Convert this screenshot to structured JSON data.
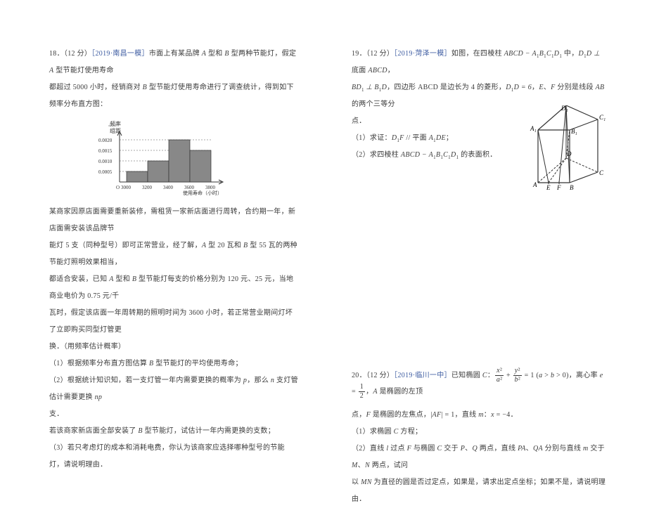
{
  "q18": {
    "num": "18．（12 分）",
    "src": "［2019·南昌一模］",
    "p1a": "市面上有某品牌 ",
    "p1b": " 型和 ",
    "p1c": " 型两种节能灯，假定 ",
    "p1d": " 型节能灯使用寿命",
    "p2a": "都超过 5000 小时，经销商对 ",
    "p2b": " 型节能灯使用寿命进行了调查统计，得到如下频率分布直方图：",
    "p3": "某商家因原店面需要重新装修，需租赁一家新店面进行周转，合约期一年，新店面需安装该品牌节",
    "p4a": "能灯 5 支（同种型号）即可正常营业，经了解，",
    "p4b": " 型 20 瓦和 ",
    "p4c": " 型 55 瓦的两种节能灯照明效果相当，",
    "p5a": "都适合安装，已知 ",
    "p5b": " 型和 ",
    "p5c": " 型节能灯每支的价格分别为 120 元、25 元，当地商业电价为 0.75 元/千",
    "p6": "瓦时，假定该店面一年周转期的照明时间为 3600 小时，若正常营业期间灯坏了立即购买同型灯管更",
    "p7": "换．（用频率估计概率）",
    "q1a": "（1）根据频率分布直方图估算 ",
    "q1b": " 型节能灯的平均使用寿命；",
    "q2a": "（2）根据统计知识知，若一支灯管一年内需要更换的概率为 ",
    "q2b": "，那么 ",
    "q2c": " 支灯管估计需要更换 ",
    "q3": "支．",
    "q4a": "若该商家新店面全部安装了 ",
    "q4b": " 型节能灯，试估计一年内需更换的支数；",
    "q5": "（3）若只考虑灯的成本和消耗电费，你认为该商家应选择哪种型号的节能灯，请说明理由．"
  },
  "q19": {
    "num": "19．（12 分）",
    "src": "［2019·菏泽一模］",
    "p1a": "如图，在四棱柱 ",
    "p1b": " 中，",
    "p1c": " 底面 ",
    "p1d": "，",
    "p2a": " 是边长为 4 的菱形，",
    "p2b": "，",
    "p2c": "、",
    "p2d": " 分别是线段 ",
    "p2e": " 的两个三等分",
    "p3": "点．",
    "q1a": "（1）求证：",
    "q1b": " 平面 ",
    "q1c": "；",
    "q2a": "（2）求四棱柱 ",
    "q2b": " 的表面积．",
    "solid": "ABCD-A1B1C1D1",
    "BD1_perp_B1D": "BD₁⊥B₁D",
    "D1D_perp": "D₁D⊥",
    "ABCD_face": "ABCD",
    "ABCD_rhombus": "，四边形 ABCD",
    "D1D_eq": "D₁D = 6",
    "E": "E",
    "F": "F",
    "AB": "AB",
    "D1F_par": "D₁F //",
    "A1DE": "A₁DE"
  },
  "q20": {
    "num": "20．（12 分）",
    "src": "［2019·临川一中］",
    "p1a": "已知椭圆 ",
    "p1b": "，离心率 ",
    "p1c": "，",
    "p1d": " 是椭圆的左顶",
    "p2a": "点，",
    "p2b": " 是椭圆的左焦点，",
    "p2c": "，直线 ",
    "p2d": "．",
    "q1a": "（1）求椭圆 ",
    "q1b": " 方程；",
    "q2a": "（2）直线 ",
    "q2b": " 过点 ",
    "q2c": " 与椭圆 ",
    "q2d": " 交于 ",
    "q2e": "、",
    "q2f": " 两点，直线 ",
    "q2g": "、",
    "q2h": " 分别与直线 ",
    "q2i": " 交于 ",
    "q2j": "、",
    "q2k": " 两点，试问",
    "q3a": "以 ",
    "q3b": " 为直径的圆是否过定点，如果是，请求出定点坐标；如果不是，请说明理由．",
    "C": "C",
    "ellipse_eq": "x²/a² + y²/b² = 1 (a>b>0)",
    "e_eq": "e = 1/2",
    "A": "A",
    "F": "F",
    "AF_eq": "|AF| = 1",
    "m_eq": "m : x = -4",
    "l": "l",
    "P": "P",
    "Q": "Q",
    "PA": "PA",
    "QA": "QA",
    "m": "m",
    "M": "M",
    "N": "N",
    "MN": "MN"
  },
  "chart_data": {
    "type": "bar",
    "title": "",
    "xlabel": "使用寿命（小时）",
    "ylabel": "频率/组距",
    "categories": [
      "3000",
      "3200",
      "3400",
      "3600",
      "3800"
    ],
    "values": [
      0.0005,
      0.001,
      0.002,
      0.0015
    ],
    "x_ticks": [
      3000,
      3200,
      3400,
      3600,
      3800
    ],
    "y_ticks": [
      0.0005,
      0.001,
      0.0015,
      0.002
    ],
    "ylim": [
      0,
      0.0022
    ]
  },
  "prism_labels": {
    "A": "A",
    "B": "B",
    "C": "C",
    "D": "D",
    "A1": "A₁",
    "B1": "B₁",
    "C1": "C₁",
    "D1": "D₁",
    "E": "E",
    "F": "F"
  }
}
